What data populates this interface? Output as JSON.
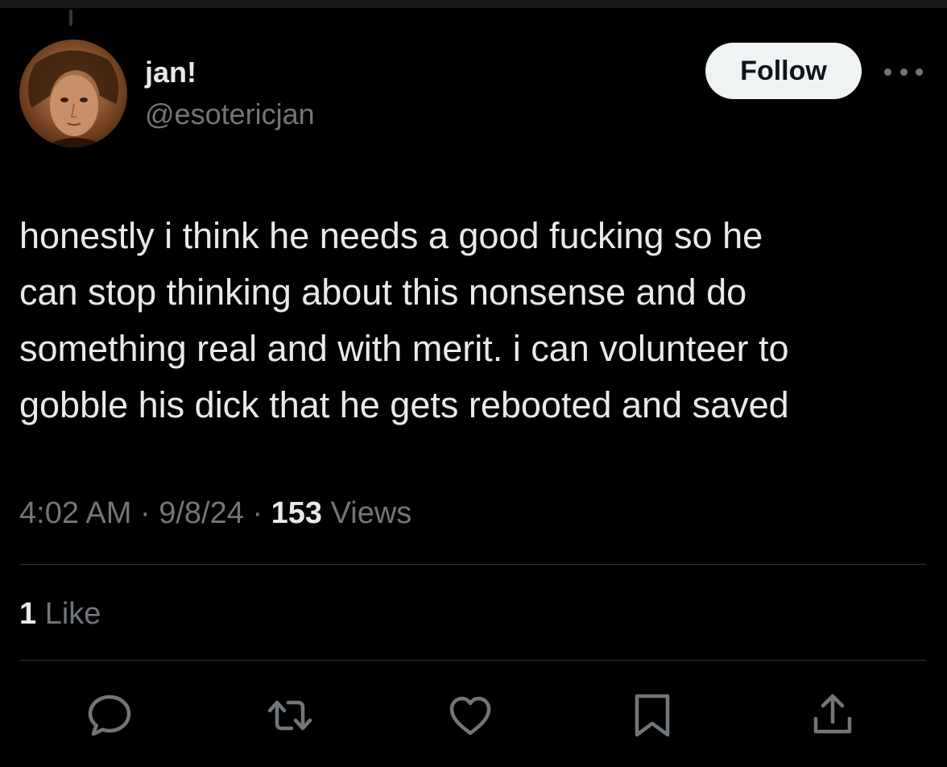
{
  "tweet": {
    "author": {
      "display_name": "jan!",
      "handle": "@esotericjan",
      "avatar_icon": "user-avatar"
    },
    "follow_label": "Follow",
    "more_icon": "more-horizontal-icon",
    "text": "honestly i think he needs a good fucking so he\ncan stop thinking about this nonsense and do\nsomething real and with merit. i can volunteer to\ngobble his dick that he gets rebooted and saved",
    "time": "4:02 AM",
    "separator": "·",
    "date": "9/8/24",
    "views_count": "153",
    "views_label": "Views",
    "likes_count": "1",
    "likes_label": "Like",
    "actions": [
      {
        "name": "reply",
        "icon": "reply-icon"
      },
      {
        "name": "retweet",
        "icon": "retweet-icon"
      },
      {
        "name": "like",
        "icon": "heart-icon"
      },
      {
        "name": "bookmark",
        "icon": "bookmark-icon"
      },
      {
        "name": "share",
        "icon": "share-icon"
      }
    ]
  },
  "colors": {
    "background": "#000000",
    "primary_text": "#e7e9ea",
    "secondary_text": "#71767b",
    "divider": "#2f3336",
    "follow_bg": "#eff3f4",
    "follow_text": "#0f1419"
  }
}
